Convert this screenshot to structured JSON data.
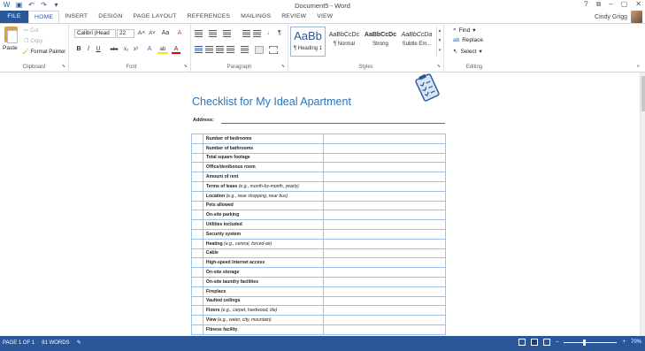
{
  "window": {
    "title": "Document5 - Word",
    "controls": [
      "?",
      "⧉",
      "–",
      "▢",
      "✕"
    ]
  },
  "qat": {
    "icons": [
      "word-logo-icon",
      "save-icon",
      "undo-icon",
      "redo-icon",
      "customize-icon"
    ]
  },
  "tabs": [
    "FILE",
    "HOME",
    "INSERT",
    "DESIGN",
    "PAGE LAYOUT",
    "REFERENCES",
    "MAILINGS",
    "REVIEW",
    "VIEW"
  ],
  "active_tab": "HOME",
  "user": {
    "name": "Cindy Grigg"
  },
  "ribbon": {
    "clipboard": {
      "label": "Clipboard",
      "paste": "Paste",
      "cut": "Cut",
      "copy": "Copy",
      "format_painter": "Format Painter"
    },
    "font": {
      "label": "Font",
      "font_name": "Calibri (Head",
      "font_size": "22",
      "grow": "A˄",
      "shrink": "A˅",
      "case": "Aa",
      "clear": "A",
      "bold": "B",
      "italic": "I",
      "underline": "U",
      "strike": "abc",
      "sub": "x₂",
      "sup": "x²",
      "effects": "A",
      "highlight": "ab",
      "color": "A"
    },
    "paragraph": {
      "label": "Paragraph",
      "pilcrow": "¶"
    },
    "styles": {
      "label": "Styles",
      "items": [
        {
          "sample": "AaBb",
          "name": "¶ Heading 1"
        },
        {
          "sample": "AaBbCcDc",
          "name": "¶ Normal"
        },
        {
          "sample": "AaBbCcDc",
          "name": "Strong"
        },
        {
          "sample": "AaBbCcDa",
          "name": "Subtle Em..."
        }
      ]
    },
    "editing": {
      "label": "Editing",
      "find": "Find",
      "replace": "Replace",
      "select": "Select"
    }
  },
  "document": {
    "heading": "Checklist for My Ideal Apartment",
    "address_label": "Address:",
    "rows": [
      {
        "item": "Number of bedrooms",
        "hint": ""
      },
      {
        "item": "Number of bathrooms",
        "hint": ""
      },
      {
        "item": "Total square footage",
        "hint": ""
      },
      {
        "item": "Office/den/bonus room",
        "hint": ""
      },
      {
        "item": "Amount of rent",
        "hint": ""
      },
      {
        "item": "Terms of lease",
        "hint": "(e.g., month-by-month, yearly)"
      },
      {
        "item": "Location",
        "hint": "(e.g., near shopping, near bus)"
      },
      {
        "item": "Pets allowed",
        "hint": ""
      },
      {
        "item": "On-site parking",
        "hint": ""
      },
      {
        "item": "Utilities included",
        "hint": ""
      },
      {
        "item": "Security system",
        "hint": ""
      },
      {
        "item": "Heating",
        "hint": "(e.g., central, forced-air)"
      },
      {
        "item": "Cable",
        "hint": ""
      },
      {
        "item": "High-speed Internet access",
        "hint": ""
      },
      {
        "item": "On-site storage",
        "hint": ""
      },
      {
        "item": "On-site laundry facilities",
        "hint": ""
      },
      {
        "item": "Fireplace",
        "hint": ""
      },
      {
        "item": "Vaulted ceilings",
        "hint": ""
      },
      {
        "item": "Floors",
        "hint": "(e.g., carpet, hardwood, tile)"
      },
      {
        "item": "View",
        "hint": "(e.g., water, city, mountain)"
      },
      {
        "item": "Fitness facility",
        "hint": ""
      }
    ]
  },
  "status": {
    "page": "PAGE 1 OF 1",
    "words": "81 WORDS",
    "zoom": "70%"
  },
  "colors": {
    "accent": "#2b579a",
    "heading": "#2e74b5",
    "table_border": "#9dc3e6"
  }
}
